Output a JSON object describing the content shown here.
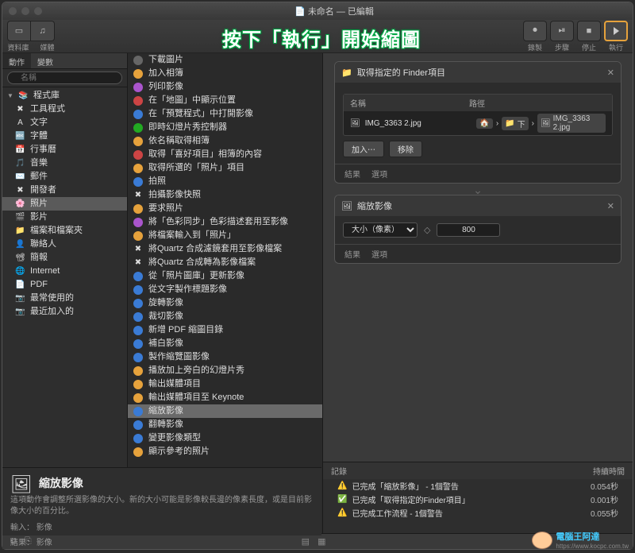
{
  "window": {
    "doc_icon": "📄",
    "title": "未命名 — 已編輯"
  },
  "toolbar": {
    "library_label": "資料庫",
    "media_label": "媒體",
    "record_label": "錄製",
    "step_label": "步驟",
    "stop_label": "停止",
    "run_label": "執行"
  },
  "callout_text": "按下「執行」開始縮圖",
  "sidebar": {
    "tab_actions": "動作",
    "tab_variables": "變數",
    "search_placeholder": "名稱",
    "root": "程式庫",
    "items": [
      {
        "label": "工具程式",
        "icon": "✖︎"
      },
      {
        "label": "文字",
        "icon": "A"
      },
      {
        "label": "字體",
        "icon": "🔤"
      },
      {
        "label": "行事曆",
        "icon": "📅"
      },
      {
        "label": "音樂",
        "icon": "🎵"
      },
      {
        "label": "郵件",
        "icon": "✉️"
      },
      {
        "label": "開發者",
        "icon": "✖︎"
      },
      {
        "label": "照片",
        "icon": "🌸",
        "selected": true
      },
      {
        "label": "影片",
        "icon": "🎬"
      },
      {
        "label": "檔案和檔案夾",
        "icon": "📁"
      },
      {
        "label": "聯絡人",
        "icon": "👤"
      },
      {
        "label": "簡報",
        "icon": "📽"
      },
      {
        "label": "Internet",
        "icon": "🌐"
      },
      {
        "label": "PDF",
        "icon": "📄"
      },
      {
        "label": "最常使用的",
        "icon": "📷"
      },
      {
        "label": "最近加入的",
        "icon": "📷"
      }
    ]
  },
  "actions": [
    {
      "label": "下載圖片",
      "color": "ic-gray"
    },
    {
      "label": "加入相簿",
      "color": "ic-yellow"
    },
    {
      "label": "列印影像",
      "color": "ic-purple"
    },
    {
      "label": "在「地圖」中顯示位置",
      "color": "ic-red"
    },
    {
      "label": "在「預覽程式」中打開影像",
      "color": "ic-blue"
    },
    {
      "label": "即時幻燈片秀控制器",
      "color": "ic-green"
    },
    {
      "label": "依名稱取得相簿",
      "color": "ic-yellow"
    },
    {
      "label": "取得「喜好項目」相簿的內容",
      "color": "ic-red"
    },
    {
      "label": "取得所選的「照片」項目",
      "color": "ic-yellow"
    },
    {
      "label": "拍照",
      "color": "ic-blue"
    },
    {
      "label": "拍攝影像快照",
      "color": "ic-gray",
      "x": true
    },
    {
      "label": "要求照片",
      "color": "ic-yellow"
    },
    {
      "label": "將「色彩同步」色彩描述套用至影像",
      "color": "ic-purple"
    },
    {
      "label": "將檔案輸入到「照片」",
      "color": "ic-yellow"
    },
    {
      "label": "將Quartz 合成濾鏡套用至影像檔案",
      "color": "ic-gray",
      "x": true
    },
    {
      "label": "將Quartz 合成轉為影像檔案",
      "color": "ic-gray",
      "x": true
    },
    {
      "label": "從「照片圖庫」更新影像",
      "color": "ic-blue"
    },
    {
      "label": "從文字製作標題影像",
      "color": "ic-blue"
    },
    {
      "label": "旋轉影像",
      "color": "ic-blue"
    },
    {
      "label": "裁切影像",
      "color": "ic-blue"
    },
    {
      "label": "新增 PDF 縮圖目錄",
      "color": "ic-blue"
    },
    {
      "label": "補白影像",
      "color": "ic-blue"
    },
    {
      "label": "製作縮覽圖影像",
      "color": "ic-blue"
    },
    {
      "label": "播放加上旁白的幻燈片秀",
      "color": "ic-yellow"
    },
    {
      "label": "輸出媒體項目",
      "color": "ic-yellow"
    },
    {
      "label": "輸出媒體項目至 Keynote",
      "color": "ic-yellow"
    },
    {
      "label": "縮放影像",
      "color": "ic-blue",
      "selected": true
    },
    {
      "label": "翻轉影像",
      "color": "ic-blue"
    },
    {
      "label": "變更影像類型",
      "color": "ic-blue"
    },
    {
      "label": "顯示參考的照片",
      "color": "ic-yellow"
    }
  ],
  "workflow": {
    "card1": {
      "title": "取得指定的 Finder項目",
      "col_name": "名稱",
      "col_path": "路徑",
      "file_icon": "🖼",
      "filename": "IMG_3363 2.jpg",
      "path_home": "🏠",
      "path_seg1": "下",
      "path_file": "IMG_3363 2.jpg",
      "btn_add": "加入⋯",
      "btn_remove": "移除",
      "foot_result": "結果",
      "foot_options": "選項"
    },
    "card2": {
      "title": "縮放影像",
      "size_label": "大小（像素）",
      "size_value": "800",
      "foot_result": "結果",
      "foot_options": "選項"
    }
  },
  "log": {
    "col_record": "記錄",
    "col_duration": "持續時間",
    "rows": [
      {
        "icon": "⚠️",
        "text": "已完成「縮放影像」 - 1個警告",
        "dur": "0.054秒"
      },
      {
        "icon": "✅",
        "text": "已完成「取得指定的Finder項目」",
        "dur": "0.001秒"
      },
      {
        "icon": "⚠️",
        "text": "已完成工作流程 - 1個警告",
        "dur": "0.055秒"
      }
    ]
  },
  "description": {
    "title": "縮放影像",
    "body": "這項動作會調整所選影像的大小。新的大小可能是影像較長邊的像素長度，或是目前影像大小的百分比。",
    "input_label": "輸入：",
    "input_value": "影像",
    "output_label": "結果：",
    "output_value": "影像"
  },
  "watermark": {
    "text": "電腦王阿達",
    "url": "https://www.kocpc.com.tw"
  }
}
